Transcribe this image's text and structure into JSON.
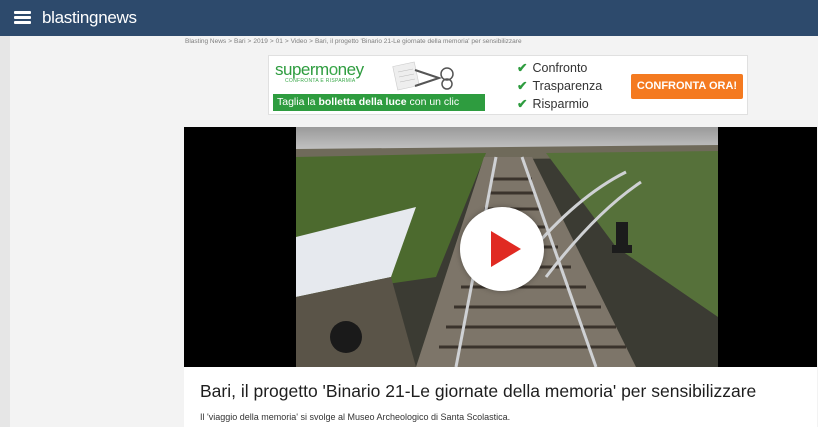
{
  "header": {
    "logo_text": "blastingnews",
    "menu_icon": "hamburger-menu-icon",
    "bar_color": "#2d4a6c"
  },
  "breadcrumb": {
    "items": [
      "Blasting News",
      "Bari",
      "2019",
      "01",
      "Video",
      "Bari, il progetto 'Binario 21-Le giornate della memoria' per sensibilizzare"
    ],
    "separator": ">"
  },
  "ad": {
    "brand_prefix": "superm",
    "brand_accent": "o",
    "brand_suffix": "ney",
    "tagline": "CONFRONTA E RISPARMIA",
    "banner_pre": "Taglia la ",
    "banner_bold": "bolletta della luce",
    "banner_post": " con un clic",
    "checks": [
      "Confronto",
      "Trasparenza",
      "Risparmio"
    ],
    "cta_label": "CONFRONTA ORA!",
    "brand_color": "#2e9c3f",
    "cta_color": "#f47a20"
  },
  "video": {
    "play_icon": "play-button-icon",
    "play_color": "#e02a22"
  },
  "article": {
    "title": "Bari, il progetto 'Binario 21-Le giornate della memoria' per sensibilizzare",
    "subtitle": "Il 'viaggio della memoria' si svolge al Museo Archeologico di Santa Scolastica."
  }
}
